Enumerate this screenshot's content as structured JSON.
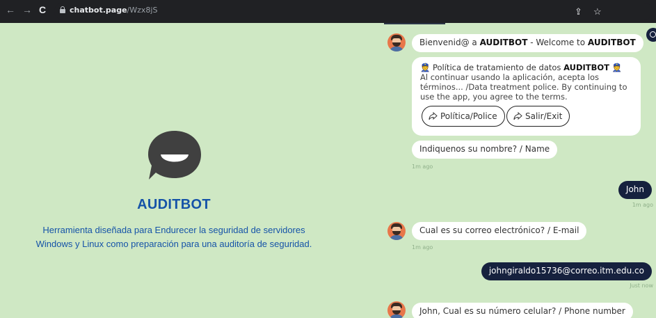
{
  "browser": {
    "url_host": "chatbot.page",
    "url_path": "/Wzx8jS",
    "back_glyph": "←",
    "forward_glyph": "→",
    "reload_glyph": "C",
    "share_glyph": "⇪",
    "star_glyph": "☆"
  },
  "left": {
    "title": "AUDITBOT",
    "description_line1": "Herramienta diseñada para Endurecer la seguridad de servidores",
    "description_line2": "Windows y Linux como preparación para una auditoría de seguridad.",
    "accent_color": "#1553a8",
    "background_color": "#cfe8c4"
  },
  "chat": {
    "welcome": {
      "prefix": "Bienvenid@ a ",
      "bold1": "AUDITBOT",
      "middle": " - Welcome to ",
      "bold2": "AUDITBOT"
    },
    "policy": {
      "emoji": "👮",
      "title_prefix": " Política de tratamiento de datos ",
      "title_bold": "AUDITBOT",
      "text": "Al continuar usando la aplicación, acepta los términos... /Data treatment police. By continuing to use the app, you agree to the terms.",
      "button_policy": "Política/Police",
      "button_exit": "Salir/Exit"
    },
    "ask_name": "Indiquenos su nombre? / Name",
    "ask_name_time": "1m ago",
    "user_name": "John",
    "user_name_time": "1m ago",
    "ask_email": "Cual es su correo electrónico? / E-mail",
    "ask_email_time": "1m ago",
    "user_email": "johngiraldo15736@correo.itm.edu.co",
    "user_email_time": "Just now",
    "ask_phone": "John, Cual es su número celular? / Phone number",
    "user_bubble_color": "#16213e"
  }
}
